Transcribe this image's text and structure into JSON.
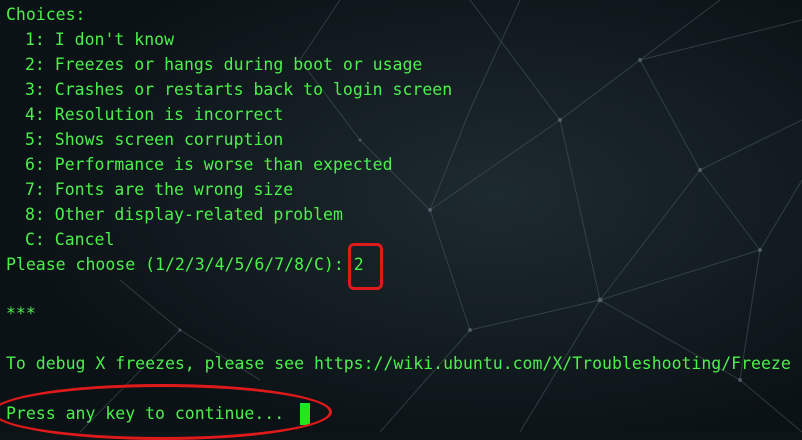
{
  "terminal": {
    "choices_header": "Choices:",
    "choices": [
      "1: I don't know",
      "2: Freezes or hangs during boot or usage",
      "3: Crashes or restarts back to login screen",
      "4: Resolution is incorrect",
      "5: Shows screen corruption",
      "6: Performance is worse than expected",
      "7: Fonts are the wrong size",
      "8: Other display-related problem",
      "C: Cancel"
    ],
    "prompt": "Please choose (1/2/3/4/5/6/7/8/C): ",
    "selected_value": "2",
    "separator": "***",
    "debug_message": "To debug X freezes, please see https://wiki.ubuntu.com/X/Troubleshooting/Freeze",
    "continue_prompt": "Press any key to continue... "
  },
  "colors": {
    "text": "#4cf04c",
    "background": "#0d1519",
    "cursor": "#23e623",
    "annotation": "#e01a1a"
  }
}
